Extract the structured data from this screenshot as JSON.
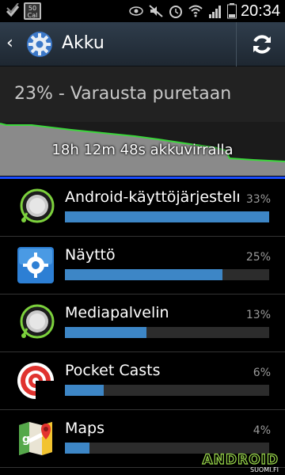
{
  "status_bar": {
    "time": "20:34",
    "battery_badge_top": "50",
    "battery_badge_bottom": "Cal",
    "icons": [
      "check-icon",
      "calendar-badge-icon",
      "eye-icon",
      "mute-icon",
      "alarm-icon",
      "wifi-icon",
      "signal-icon",
      "battery-icon"
    ]
  },
  "action_bar": {
    "title": "Akku",
    "icons": [
      "back-icon",
      "settings-gear-icon",
      "refresh-icon"
    ]
  },
  "summary": {
    "text": "23% - Varausta puretaan"
  },
  "graph": {
    "label": "18h 12m 48s akkuvirralla"
  },
  "colors": {
    "bar": "#3d86c6",
    "graph_line": "#3bd63b",
    "divider": "#1a4cff"
  },
  "items": [
    {
      "label": "Android-käyttöjärjestelm",
      "percent": "33%",
      "fraction": 1.0,
      "icon": "android-os-icon"
    },
    {
      "label": "Näyttö",
      "percent": "25%",
      "fraction": 0.77,
      "icon": "display-settings-icon"
    },
    {
      "label": "Mediapalvelin",
      "percent": "13%",
      "fraction": 0.4,
      "icon": "media-server-icon"
    },
    {
      "label": "Pocket Casts",
      "percent": "6%",
      "fraction": 0.19,
      "icon": "pocket-casts-icon"
    },
    {
      "label": "Maps",
      "percent": "4%",
      "fraction": 0.12,
      "icon": "maps-icon"
    }
  ],
  "watermark": {
    "logo_text": "ANDROID",
    "sub_text": "SUOMI.FI"
  }
}
